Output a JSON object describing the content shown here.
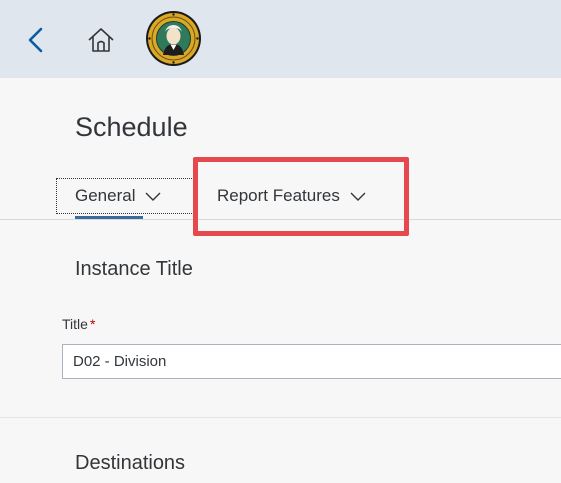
{
  "shell": {
    "back_icon": "chevron-left-icon",
    "home_icon": "home-icon",
    "logo_icon": "washington-state-seal"
  },
  "page": {
    "title": "Schedule"
  },
  "tabs": [
    {
      "label": "General",
      "icon": "chevron-down-icon",
      "selected": true
    },
    {
      "label": "Report Features",
      "icon": "chevron-down-icon",
      "selected": false
    }
  ],
  "sections": {
    "instance": {
      "title": "Instance Title",
      "title_field": {
        "label": "Title",
        "required_mark": "*",
        "value": "D02 - Division"
      }
    },
    "destinations": {
      "title": "Destinations"
    }
  },
  "colors": {
    "shell_bg": "#dfe6ee",
    "page_bg": "#f7f7f7",
    "tab_underline": "#3c6b9e",
    "highlight": "#e5484d",
    "required": "#bb0000"
  }
}
